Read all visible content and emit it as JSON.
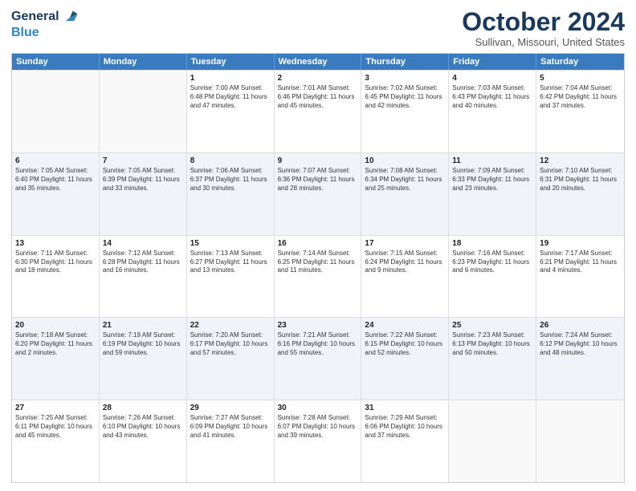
{
  "header": {
    "logo_general": "General",
    "logo_blue": "Blue",
    "month_title": "October 2024",
    "subtitle": "Sullivan, Missouri, United States"
  },
  "weekdays": [
    "Sunday",
    "Monday",
    "Tuesday",
    "Wednesday",
    "Thursday",
    "Friday",
    "Saturday"
  ],
  "weeks": [
    [
      {
        "day": "",
        "text": "",
        "shaded": false,
        "empty": true
      },
      {
        "day": "",
        "text": "",
        "shaded": false,
        "empty": true
      },
      {
        "day": "1",
        "text": "Sunrise: 7:00 AM\nSunset: 6:48 PM\nDaylight: 11 hours and 47 minutes.",
        "shaded": false,
        "empty": false
      },
      {
        "day": "2",
        "text": "Sunrise: 7:01 AM\nSunset: 6:46 PM\nDaylight: 11 hours and 45 minutes.",
        "shaded": false,
        "empty": false
      },
      {
        "day": "3",
        "text": "Sunrise: 7:02 AM\nSunset: 6:45 PM\nDaylight: 11 hours and 42 minutes.",
        "shaded": false,
        "empty": false
      },
      {
        "day": "4",
        "text": "Sunrise: 7:03 AM\nSunset: 6:43 PM\nDaylight: 11 hours and 40 minutes.",
        "shaded": false,
        "empty": false
      },
      {
        "day": "5",
        "text": "Sunrise: 7:04 AM\nSunset: 6:42 PM\nDaylight: 11 hours and 37 minutes.",
        "shaded": false,
        "empty": false
      }
    ],
    [
      {
        "day": "6",
        "text": "Sunrise: 7:05 AM\nSunset: 6:40 PM\nDaylight: 11 hours and 35 minutes.",
        "shaded": true,
        "empty": false
      },
      {
        "day": "7",
        "text": "Sunrise: 7:05 AM\nSunset: 6:39 PM\nDaylight: 11 hours and 33 minutes.",
        "shaded": true,
        "empty": false
      },
      {
        "day": "8",
        "text": "Sunrise: 7:06 AM\nSunset: 6:37 PM\nDaylight: 11 hours and 30 minutes.",
        "shaded": true,
        "empty": false
      },
      {
        "day": "9",
        "text": "Sunrise: 7:07 AM\nSunset: 6:36 PM\nDaylight: 11 hours and 28 minutes.",
        "shaded": true,
        "empty": false
      },
      {
        "day": "10",
        "text": "Sunrise: 7:08 AM\nSunset: 6:34 PM\nDaylight: 11 hours and 25 minutes.",
        "shaded": true,
        "empty": false
      },
      {
        "day": "11",
        "text": "Sunrise: 7:09 AM\nSunset: 6:33 PM\nDaylight: 11 hours and 23 minutes.",
        "shaded": true,
        "empty": false
      },
      {
        "day": "12",
        "text": "Sunrise: 7:10 AM\nSunset: 6:31 PM\nDaylight: 11 hours and 20 minutes.",
        "shaded": true,
        "empty": false
      }
    ],
    [
      {
        "day": "13",
        "text": "Sunrise: 7:11 AM\nSunset: 6:30 PM\nDaylight: 11 hours and 18 minutes.",
        "shaded": false,
        "empty": false
      },
      {
        "day": "14",
        "text": "Sunrise: 7:12 AM\nSunset: 6:28 PM\nDaylight: 11 hours and 16 minutes.",
        "shaded": false,
        "empty": false
      },
      {
        "day": "15",
        "text": "Sunrise: 7:13 AM\nSunset: 6:27 PM\nDaylight: 11 hours and 13 minutes.",
        "shaded": false,
        "empty": false
      },
      {
        "day": "16",
        "text": "Sunrise: 7:14 AM\nSunset: 6:25 PM\nDaylight: 11 hours and 11 minutes.",
        "shaded": false,
        "empty": false
      },
      {
        "day": "17",
        "text": "Sunrise: 7:15 AM\nSunset: 6:24 PM\nDaylight: 11 hours and 9 minutes.",
        "shaded": false,
        "empty": false
      },
      {
        "day": "18",
        "text": "Sunrise: 7:16 AM\nSunset: 6:23 PM\nDaylight: 11 hours and 6 minutes.",
        "shaded": false,
        "empty": false
      },
      {
        "day": "19",
        "text": "Sunrise: 7:17 AM\nSunset: 6:21 PM\nDaylight: 11 hours and 4 minutes.",
        "shaded": false,
        "empty": false
      }
    ],
    [
      {
        "day": "20",
        "text": "Sunrise: 7:18 AM\nSunset: 6:20 PM\nDaylight: 11 hours and 2 minutes.",
        "shaded": true,
        "empty": false
      },
      {
        "day": "21",
        "text": "Sunrise: 7:19 AM\nSunset: 6:19 PM\nDaylight: 10 hours and 59 minutes.",
        "shaded": true,
        "empty": false
      },
      {
        "day": "22",
        "text": "Sunrise: 7:20 AM\nSunset: 6:17 PM\nDaylight: 10 hours and 57 minutes.",
        "shaded": true,
        "empty": false
      },
      {
        "day": "23",
        "text": "Sunrise: 7:21 AM\nSunset: 6:16 PM\nDaylight: 10 hours and 55 minutes.",
        "shaded": true,
        "empty": false
      },
      {
        "day": "24",
        "text": "Sunrise: 7:22 AM\nSunset: 6:15 PM\nDaylight: 10 hours and 52 minutes.",
        "shaded": true,
        "empty": false
      },
      {
        "day": "25",
        "text": "Sunrise: 7:23 AM\nSunset: 6:13 PM\nDaylight: 10 hours and 50 minutes.",
        "shaded": true,
        "empty": false
      },
      {
        "day": "26",
        "text": "Sunrise: 7:24 AM\nSunset: 6:12 PM\nDaylight: 10 hours and 48 minutes.",
        "shaded": true,
        "empty": false
      }
    ],
    [
      {
        "day": "27",
        "text": "Sunrise: 7:25 AM\nSunset: 6:11 PM\nDaylight: 10 hours and 45 minutes.",
        "shaded": false,
        "empty": false
      },
      {
        "day": "28",
        "text": "Sunrise: 7:26 AM\nSunset: 6:10 PM\nDaylight: 10 hours and 43 minutes.",
        "shaded": false,
        "empty": false
      },
      {
        "day": "29",
        "text": "Sunrise: 7:27 AM\nSunset: 6:09 PM\nDaylight: 10 hours and 41 minutes.",
        "shaded": false,
        "empty": false
      },
      {
        "day": "30",
        "text": "Sunrise: 7:28 AM\nSunset: 6:07 PM\nDaylight: 10 hours and 39 minutes.",
        "shaded": false,
        "empty": false
      },
      {
        "day": "31",
        "text": "Sunrise: 7:29 AM\nSunset: 6:06 PM\nDaylight: 10 hours and 37 minutes.",
        "shaded": false,
        "empty": false
      },
      {
        "day": "",
        "text": "",
        "shaded": false,
        "empty": true
      },
      {
        "day": "",
        "text": "",
        "shaded": false,
        "empty": true
      }
    ]
  ]
}
